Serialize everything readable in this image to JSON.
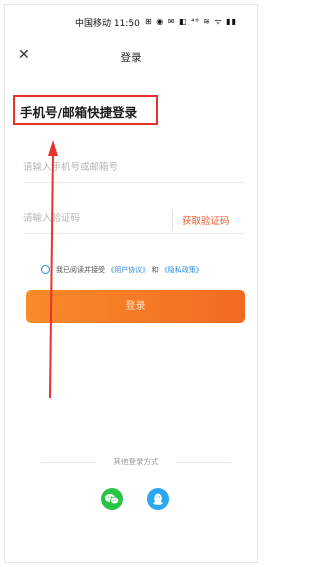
{
  "statusbar": {
    "carrier_time": "中国移动 11:50",
    "icons": "⊞ ◉ ✉ ◧ ⁴⁶ ≋ ᯤ ▮▮"
  },
  "navbar": {
    "close_label": "✕",
    "title": "登录"
  },
  "headline": "手机号/邮箱快捷登录",
  "form": {
    "phone_placeholder": "请输入手机号或邮箱号",
    "code_placeholder": "请输入验证码",
    "get_code_label": "获取验证码"
  },
  "agreement": {
    "prefix": "我已阅读并接受",
    "user_agreement": "《用户协议》",
    "and": "和",
    "privacy_policy": "《隐私政策》"
  },
  "login_button_label": "登录",
  "other_login_title": "其他登录方式",
  "colors": {
    "accent_orange": "#f26a22",
    "highlight_red": "#e8322d",
    "link_blue": "#2b8ae0",
    "wechat_green": "#28c446",
    "qq_blue": "#29a8f1"
  },
  "icons": {
    "wechat": "wechat-icon",
    "qq": "qq-icon"
  }
}
